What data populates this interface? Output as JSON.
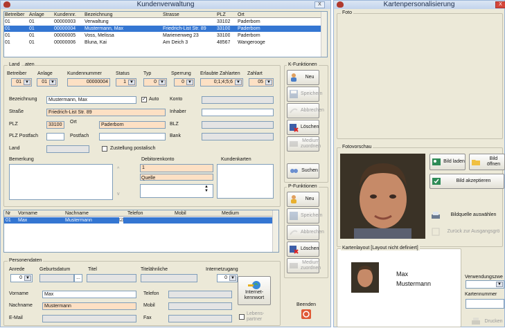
{
  "main_window": {
    "title": "Kundenverwaltung",
    "close": "X"
  },
  "customers": {
    "headers": [
      "Betreiber",
      "Anlage",
      "Kundennr.",
      "Bezeichnung",
      "Strasse",
      "PLZ",
      "Ort"
    ],
    "rows": [
      [
        "01",
        "01",
        "00000003",
        "Verwaltung",
        "",
        "33102",
        "Paderborn"
      ],
      [
        "01",
        "01",
        "00000004",
        "Mustermann, Max",
        "Friedrich-List Str. 89",
        "33100",
        "Paderborn"
      ],
      [
        "01",
        "01",
        "00000005",
        "Voss, Melissa",
        "Marienenweg 23",
        "33100",
        "Paderborn"
      ],
      [
        "01",
        "01",
        "00000006",
        "Bluna, Kai",
        "Am Deich 3",
        "48567",
        "Wangerooge"
      ]
    ],
    "selected_index": 1
  },
  "form": {
    "land_label": "Land",
    "daten_label": "aten",
    "labels": {
      "betreiber": "Betreiber",
      "anlage": "Anlage",
      "kundennummer": "Kundennummer",
      "status": "Status",
      "typ": "Typ",
      "sperrung": "Sperrung",
      "zahlarten": "Erlaubte Zahlarten",
      "zahlart": "Zahlart"
    },
    "values": {
      "betreiber": "01",
      "anlage": "01",
      "kundennummer": "00000004",
      "status": "1",
      "typ": "0",
      "sperrung": "0",
      "zahlarten": "0;1;4;5;6",
      "zahlart": "05"
    },
    "bezeichnung_label": "Bezeichnung",
    "bezeichnung": "Mustermann, Max",
    "auto_label": "Auto",
    "auto_checked": true,
    "konto_label": "Konto",
    "inhaber_label": "Inhaber",
    "blz_label": "BLZ",
    "bank_label": "Bank",
    "strasse_label": "Straße",
    "strasse": "Friedrich-List Str. 89",
    "plz_label": "PLZ",
    "plz": "33100",
    "ort_label": "Ort",
    "ort": "Paderborn",
    "plz_postfach_label": "PLZ Postfach",
    "postfach_label": "Postfach",
    "land2_label": "Land",
    "zustellung_label": "Zustellung postalisch",
    "bemerkung_label": "Bemerkung",
    "debitorenkonto_label": "Debitorenkonto",
    "debitorenkonto": "1",
    "quelle_label": "Quelle",
    "kundenkarten_label": "Kundenkarten"
  },
  "k_funktionen": {
    "label": "K-Funktionen",
    "neu": "Neu",
    "speichern": "Speichern",
    "abbrechen": "Abbrechen",
    "loeschen": "Löschen",
    "medium_zuordnen": "Medium zuordnen",
    "suchen": "Suchen"
  },
  "persons": {
    "headers": [
      "Nr",
      "Vorname",
      "Nachname",
      "Telefon",
      "Mobil",
      "Medium"
    ],
    "rows": [
      [
        "01",
        "Max",
        "Mustermann",
        "☑",
        "",
        ""
      ]
    ]
  },
  "p_funktionen": {
    "label": "P-Funktionen",
    "neu": "Neu",
    "speichern": "Speichern",
    "abbrechen": "Abbrechen",
    "loeschen": "Löschen",
    "medium_zuordnen": "Medium zuordnen"
  },
  "personendaten": {
    "label": "Personendaten",
    "anrede_label": "Anrede",
    "anrede": "0",
    "geburtsdatum_label": "Geburtsdatum",
    "ellipsis": "...",
    "titel_label": "Titel",
    "titelaehnliche_label": "Titelähnliche",
    "internetzugang_label": "Internetzugang",
    "internetzugang": "0",
    "internet_kennwort": "Internet-kennwort",
    "vorname_label": "Vorname",
    "vorname": "Max",
    "nachname_label": "Nachname",
    "nachname": "Mustermann",
    "email_label": "E-Mail",
    "telefon_label": "Telefon",
    "mobil_label": "Mobil",
    "fax_label": "Fax",
    "lebenspartner_label": "Lebens-partner"
  },
  "beenden": "Beenden",
  "right_window": {
    "title": "Kartenpersonalisierung",
    "close": "X"
  },
  "foto_label": "Foto",
  "fotovorschau_label": "Fotovorschau",
  "photo_buttons": {
    "bild_laden": "Bild laden",
    "bild_oeffnen": "Bild öffnen",
    "bild_akzeptieren": "Bild akzeptieren",
    "bildquelle": "Bildquelle auswählen",
    "zurueck": "Zurück zur Ausgangsgrö"
  },
  "kartenlayout_label": "Kartenlayout [Layout nicht definiert]",
  "card": {
    "vorname": "Max",
    "nachname": "Mustermann"
  },
  "verwendungszweck_label": "Verwendungszwe",
  "kartennummer_label": "Kartennummer",
  "drucken": "Drucken",
  "colors": {
    "selected": "#3476d2",
    "field_highlight": "#fde0c4",
    "window_bg": "#ece9d8"
  }
}
